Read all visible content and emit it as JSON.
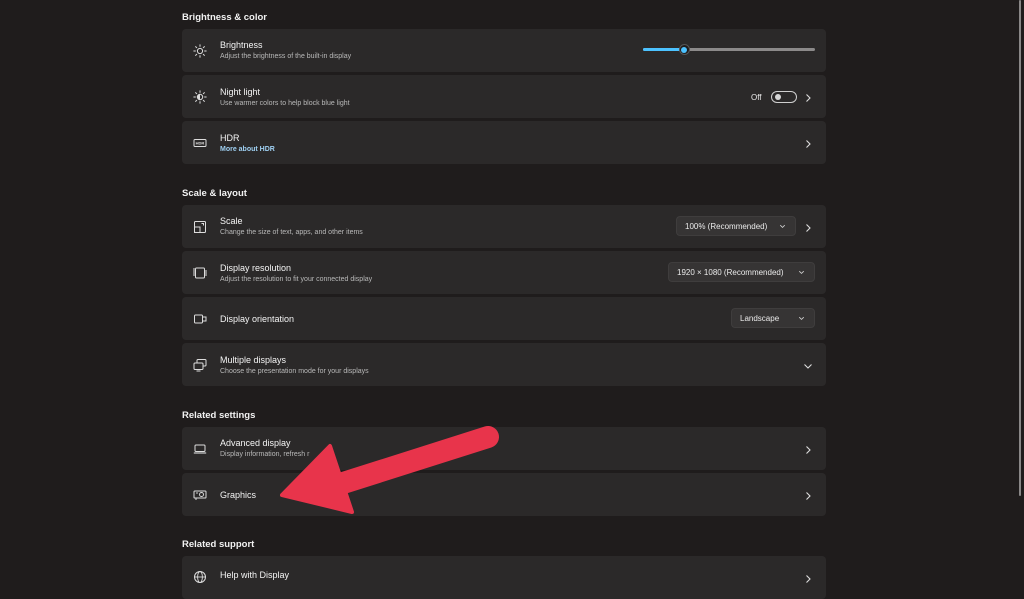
{
  "sections": {
    "brightness_color": "Brightness & color",
    "scale_layout": "Scale & layout",
    "related_settings": "Related settings",
    "related_support": "Related support"
  },
  "brightness": {
    "title": "Brightness",
    "desc": "Adjust the brightness of the built-in display",
    "level_percent": 24,
    "icon": "sun-icon"
  },
  "night_light": {
    "title": "Night light",
    "desc": "Use warmer colors to help block blue light",
    "toggle_label": "Off",
    "icon": "night-light-icon"
  },
  "hdr": {
    "title": "HDR",
    "link": "More about HDR",
    "icon": "hdr-icon"
  },
  "scale": {
    "title": "Scale",
    "desc": "Change the size of text, apps, and other items",
    "value": "100% (Recommended)",
    "icon": "scale-icon"
  },
  "resolution": {
    "title": "Display resolution",
    "desc": "Adjust the resolution to fit your connected display",
    "value": "1920 × 1080 (Recommended)",
    "icon": "resolution-icon"
  },
  "orientation": {
    "title": "Display orientation",
    "value": "Landscape",
    "icon": "orientation-icon"
  },
  "multiple_displays": {
    "title": "Multiple displays",
    "desc": "Choose the presentation mode for your displays",
    "icon": "multiple-displays-icon"
  },
  "advanced_display": {
    "title": "Advanced display",
    "desc": "Display information, refresh r",
    "icon": "laptop-icon"
  },
  "graphics": {
    "title": "Graphics",
    "icon": "graphics-card-icon"
  },
  "help": {
    "title": "Help with Display",
    "icon": "globe-icon"
  },
  "colors": {
    "background": "#1f1c1c",
    "card": "#2b2929",
    "accent": "#4cc2ff",
    "arrow": "#e8344b"
  }
}
